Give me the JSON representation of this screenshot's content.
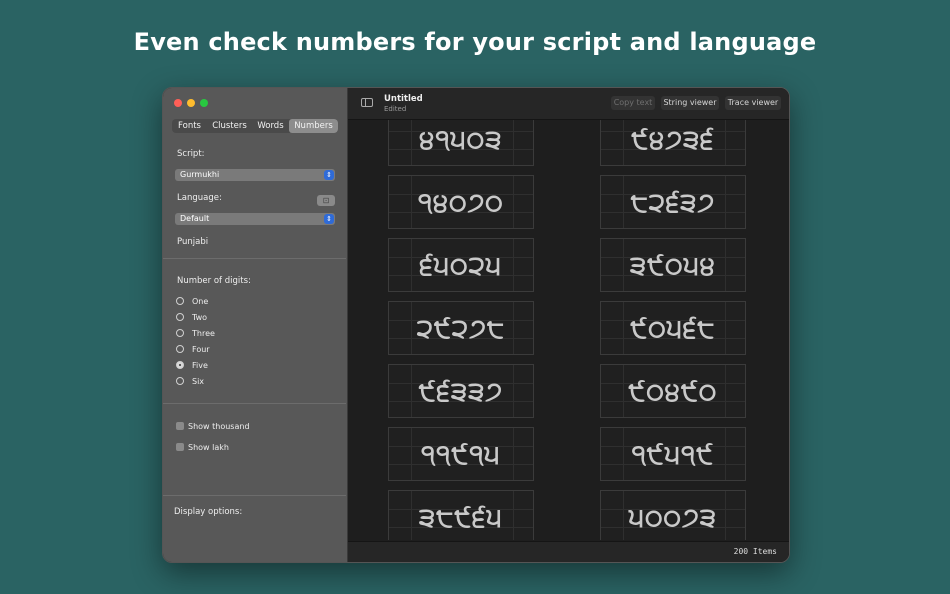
{
  "headline": "Even check numbers for your script and language",
  "sidebar": {
    "tabs": [
      "Fonts",
      "Clusters",
      "Words",
      "Numbers"
    ],
    "script_label": "Script:",
    "script_value": "Gurmukhi",
    "language_label": "Language:",
    "language_value": "Default",
    "language_name": "Punjabi",
    "digits_label": "Number of digits:",
    "digits_options": [
      "One",
      "Two",
      "Three",
      "Four",
      "Five",
      "Six"
    ],
    "digits_selected": "Five",
    "show_thousand": "Show thousand",
    "show_lakh": "Show lakh",
    "display_options": "Display options:"
  },
  "toolbar": {
    "doc_title": "Untitled",
    "doc_status": "Edited",
    "copy_text": "Copy text",
    "string_viewer": "String viewer",
    "trace_viewer": "Trace viewer"
  },
  "numbers": [
    "੪੧੫੦੩",
    "੯੪੭੩੬",
    "੧੪੦੭੦",
    "੮੨੬੩੭",
    "੬੫੦੨੫",
    "੩੯੦੫੪",
    "੨੯੨੭੮",
    "੯੦੫੬੮",
    "੯੬੩੩੭",
    "੯੦੪੯੦",
    "੧੧੯੧੫",
    "੧੯੫੧੯",
    "੩੮੯੬੫",
    "੫੦੦੭੩"
  ],
  "status_count": "200 Items",
  "colors": {
    "background": "#2a6363",
    "accent": "#2f6bd8"
  }
}
